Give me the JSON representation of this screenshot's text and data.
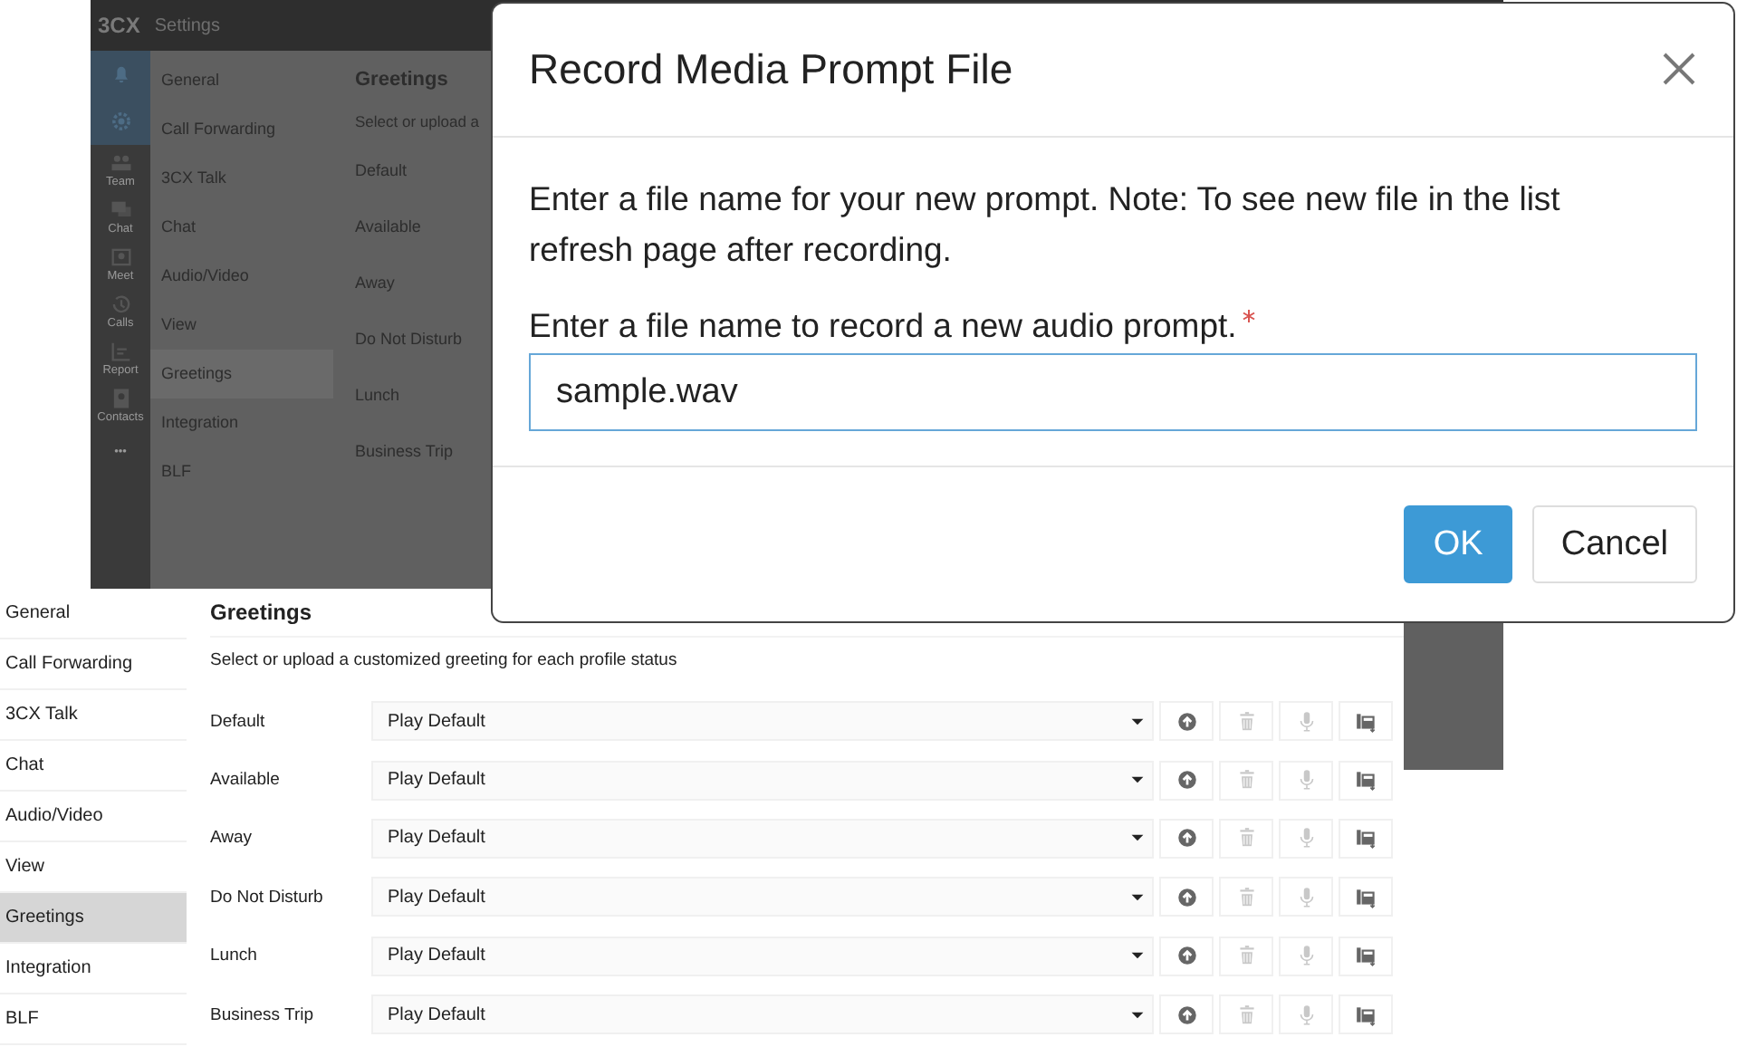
{
  "background_app": {
    "logo": "3CX",
    "title": "Settings",
    "rail": [
      {
        "kind": "bell",
        "selected": true
      },
      {
        "kind": "gear",
        "selected": true
      },
      {
        "kind": "people",
        "label": "Team",
        "selected": false
      },
      {
        "kind": "chat",
        "label": "Chat",
        "selected": false
      },
      {
        "kind": "meet",
        "label": "Meet",
        "selected": false
      },
      {
        "kind": "calls",
        "label": "Calls",
        "selected": false
      },
      {
        "kind": "report",
        "label": "Report",
        "selected": false
      },
      {
        "kind": "contacts",
        "label": "Contacts",
        "selected": false
      },
      {
        "kind": "more",
        "label": "•••",
        "selected": false
      }
    ],
    "menu": [
      {
        "label": "General",
        "selected": false
      },
      {
        "label": "Call Forwarding",
        "selected": false
      },
      {
        "label": "3CX Talk",
        "selected": false
      },
      {
        "label": "Chat",
        "selected": false
      },
      {
        "label": "Audio/Video",
        "selected": false
      },
      {
        "label": "View",
        "selected": false
      },
      {
        "label": "Greetings",
        "selected": true
      },
      {
        "label": "Integration",
        "selected": false
      },
      {
        "label": "BLF",
        "selected": false
      }
    ],
    "heading": "Greetings",
    "description": "Select or upload a",
    "rows": [
      "Default",
      "Available",
      "Away",
      "Do Not Disturb",
      "Lunch",
      "Business Trip"
    ]
  },
  "dialog": {
    "title": "Record Media Prompt File",
    "message": "Enter a file name for your new prompt. Note: To see new file in the list refresh page after recording.",
    "field_label": "Enter a file name to record a new audio prompt.",
    "required": true,
    "field_value": "sample.wav",
    "focused": true,
    "buttons": [
      {
        "label": "OK",
        "kind": "primary"
      },
      {
        "label": "Cancel",
        "kind": "secondary"
      }
    ]
  },
  "settings_panel": {
    "menu": [
      {
        "label": "General",
        "selected": false
      },
      {
        "label": "Call Forwarding",
        "selected": false
      },
      {
        "label": "3CX Talk",
        "selected": false
      },
      {
        "label": "Chat",
        "selected": false
      },
      {
        "label": "Audio/Video",
        "selected": false
      },
      {
        "label": "View",
        "selected": false
      },
      {
        "label": "Greetings",
        "selected": true
      },
      {
        "label": "Integration",
        "selected": false
      },
      {
        "label": "BLF",
        "selected": false
      }
    ],
    "heading": "Greetings",
    "description": "Select or upload a customized greeting for each profile status",
    "rows": [
      {
        "label": "Default",
        "value": "Play Default",
        "actions": [
          {
            "kind": "upload",
            "disabled": false
          },
          {
            "kind": "delete",
            "disabled": true
          },
          {
            "kind": "record",
            "disabled": true
          },
          {
            "kind": "phone",
            "disabled": false
          }
        ]
      },
      {
        "label": "Available",
        "value": "Play Default",
        "actions": [
          {
            "kind": "upload",
            "disabled": false
          },
          {
            "kind": "delete",
            "disabled": true
          },
          {
            "kind": "record",
            "disabled": true
          },
          {
            "kind": "phone",
            "disabled": false
          }
        ]
      },
      {
        "label": "Away",
        "value": "Play Default",
        "actions": [
          {
            "kind": "upload",
            "disabled": false
          },
          {
            "kind": "delete",
            "disabled": true
          },
          {
            "kind": "record",
            "disabled": true
          },
          {
            "kind": "phone",
            "disabled": false
          }
        ]
      },
      {
        "label": "Do Not Disturb",
        "value": "Play Default",
        "actions": [
          {
            "kind": "upload",
            "disabled": false
          },
          {
            "kind": "delete",
            "disabled": true
          },
          {
            "kind": "record",
            "disabled": true
          },
          {
            "kind": "phone",
            "disabled": false
          }
        ]
      },
      {
        "label": "Lunch",
        "value": "Play Default",
        "actions": [
          {
            "kind": "upload",
            "disabled": false
          },
          {
            "kind": "delete",
            "disabled": true
          },
          {
            "kind": "record",
            "disabled": true
          },
          {
            "kind": "phone",
            "disabled": false
          }
        ]
      },
      {
        "label": "Business Trip",
        "value": "Play Default",
        "actions": [
          {
            "kind": "upload",
            "disabled": false
          },
          {
            "kind": "delete",
            "disabled": true
          },
          {
            "kind": "record",
            "disabled": true
          },
          {
            "kind": "phone",
            "disabled": false
          }
        ]
      }
    ]
  }
}
